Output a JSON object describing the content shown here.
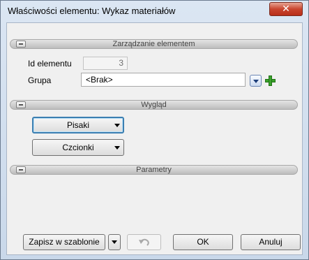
{
  "window": {
    "title": "Właściwości elementu: Wykaz materiałów",
    "close_icon": "close-x-icon"
  },
  "sections": {
    "management": "Zarządzanie elementem",
    "appearance": "Wygląd",
    "parameters": "Parametry"
  },
  "fields": {
    "id_label": "Id elementu",
    "id_value": "3",
    "group_label": "Grupa",
    "group_value": "<Brak>"
  },
  "appearance": {
    "pens_label": "Pisaki",
    "fonts_label": "Czcionki"
  },
  "footer": {
    "save_template_label": "Zapisz w szablonie",
    "ok_label": "OK",
    "cancel_label": "Anuluj"
  },
  "colors": {
    "accent_focus": "#3c7fb1",
    "plus_green": "#3aa12b",
    "close_red": "#c9452e"
  }
}
